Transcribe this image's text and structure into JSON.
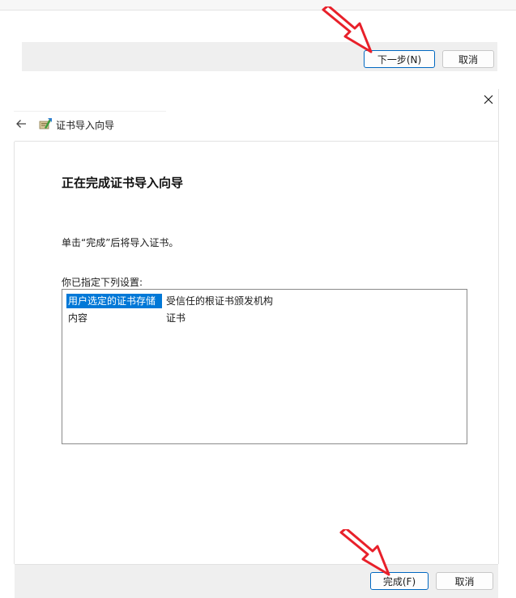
{
  "top_dialog": {
    "next_button": "下一步(N)",
    "cancel_button": "取消"
  },
  "wizard": {
    "title": "证书导入向导",
    "heading": "正在完成证书导入向导",
    "instruction": "单击“完成”后将导入证书。",
    "settings_label": "你已指定下列设置:",
    "settings": [
      {
        "key": "用户选定的证书存储",
        "value": "受信任的根证书颁发机构",
        "selected": true
      },
      {
        "key": "内容",
        "value": "证书",
        "selected": false
      }
    ],
    "finish_button": "完成(F)",
    "cancel_button": "取消"
  },
  "icons": {
    "close": "close-icon",
    "back": "back-arrow-icon",
    "wizard": "certificate-icon",
    "annotation": "red-arrow-icon"
  },
  "colors": {
    "selection": "#0078d7",
    "primary_button_border": "#0067c0",
    "footer_background": "#efefef",
    "annotation_red": "#e8202a"
  }
}
